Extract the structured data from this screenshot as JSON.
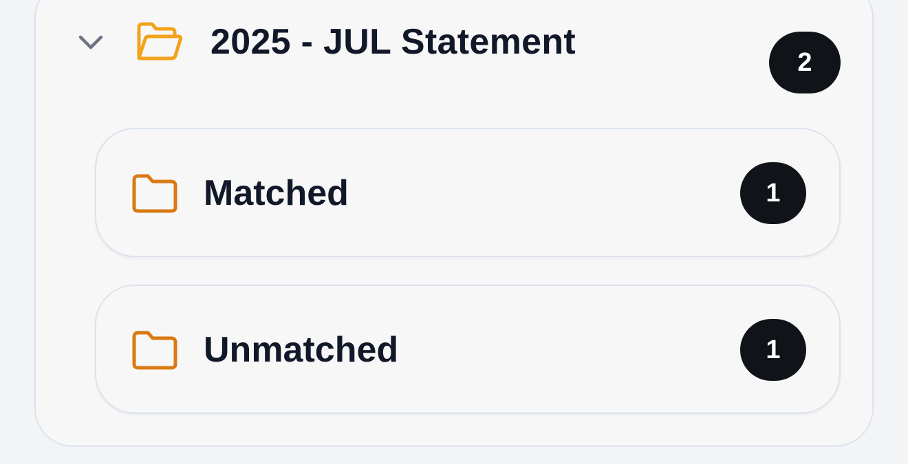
{
  "group": {
    "title": "2025 - JUL Statement",
    "count": "2",
    "expanded": true,
    "icons": {
      "toggle": "chevron-down-icon",
      "folder": "folder-open-icon"
    },
    "colors": {
      "folder_open": "#f2a31b",
      "chevron": "#6b7280",
      "badge_bg": "#101418"
    },
    "children": [
      {
        "label": "Matched",
        "count": "1",
        "icon": "folder-icon",
        "icon_color": "#d97a12"
      },
      {
        "label": "Unmatched",
        "count": "1",
        "icon": "folder-icon",
        "icon_color": "#d97a12"
      }
    ]
  }
}
